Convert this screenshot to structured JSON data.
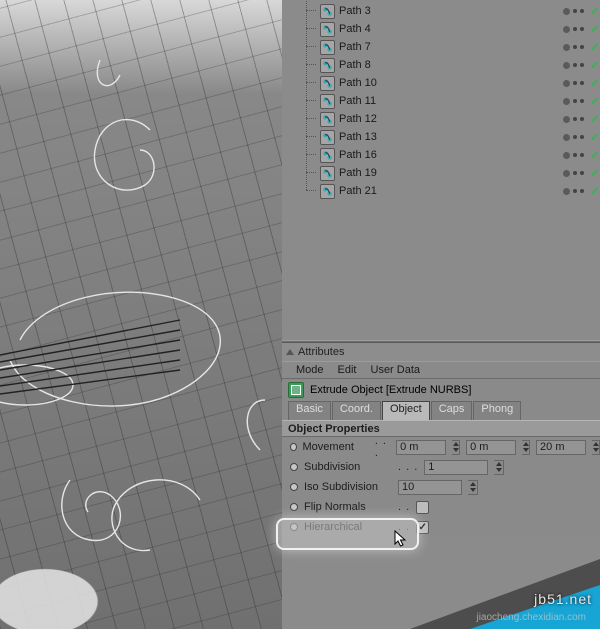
{
  "tree": [
    {
      "label": "Path 3"
    },
    {
      "label": "Path 4"
    },
    {
      "label": "Path 7"
    },
    {
      "label": "Path 8"
    },
    {
      "label": "Path 10"
    },
    {
      "label": "Path 11"
    },
    {
      "label": "Path 12"
    },
    {
      "label": "Path 13"
    },
    {
      "label": "Path 16"
    },
    {
      "label": "Path 19"
    },
    {
      "label": "Path 21"
    }
  ],
  "attr": {
    "title": "Attributes",
    "menu": {
      "mode": "Mode",
      "edit": "Edit",
      "userdata": "User Data"
    },
    "object_title": "Extrude Object [Extrude NURBS]",
    "tabs": {
      "basic": "Basic",
      "coord": "Coord.",
      "object": "Object",
      "caps": "Caps",
      "phong": "Phong"
    },
    "props_title": "Object Properties",
    "movement": {
      "label": "Movement",
      "x": "0 m",
      "y": "0 m",
      "z": "20 m"
    },
    "subdivision": {
      "label": "Subdivision",
      "value": "1"
    },
    "iso": {
      "label": "Iso Subdivision",
      "value": "10"
    },
    "flip": {
      "label": "Flip Normals"
    },
    "hier": {
      "label": "Hierarchical"
    }
  },
  "watermark": {
    "brand": "jb51.net",
    "sub": "jiaocheng.chexidian.com"
  }
}
